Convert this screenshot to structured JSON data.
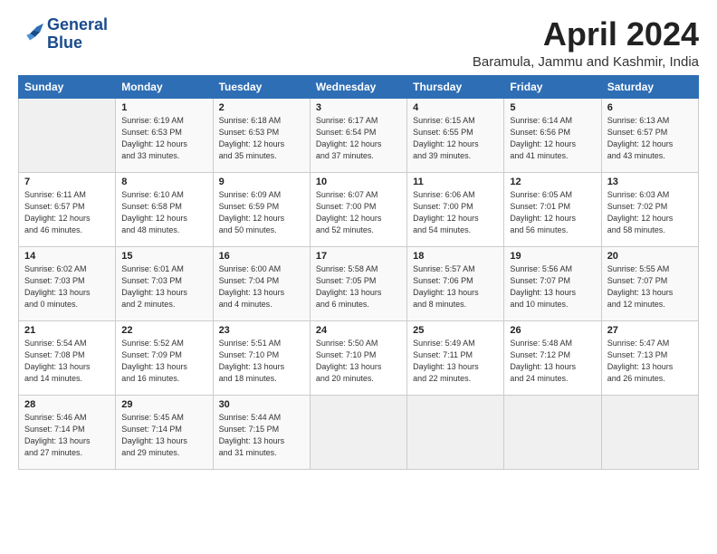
{
  "logo": {
    "line1": "General",
    "line2": "Blue"
  },
  "title": "April 2024",
  "location": "Baramula, Jammu and Kashmir, India",
  "days_of_week": [
    "Sunday",
    "Monday",
    "Tuesday",
    "Wednesday",
    "Thursday",
    "Friday",
    "Saturday"
  ],
  "weeks": [
    [
      {
        "day": "",
        "info": ""
      },
      {
        "day": "1",
        "info": "Sunrise: 6:19 AM\nSunset: 6:53 PM\nDaylight: 12 hours\nand 33 minutes."
      },
      {
        "day": "2",
        "info": "Sunrise: 6:18 AM\nSunset: 6:53 PM\nDaylight: 12 hours\nand 35 minutes."
      },
      {
        "day": "3",
        "info": "Sunrise: 6:17 AM\nSunset: 6:54 PM\nDaylight: 12 hours\nand 37 minutes."
      },
      {
        "day": "4",
        "info": "Sunrise: 6:15 AM\nSunset: 6:55 PM\nDaylight: 12 hours\nand 39 minutes."
      },
      {
        "day": "5",
        "info": "Sunrise: 6:14 AM\nSunset: 6:56 PM\nDaylight: 12 hours\nand 41 minutes."
      },
      {
        "day": "6",
        "info": "Sunrise: 6:13 AM\nSunset: 6:57 PM\nDaylight: 12 hours\nand 43 minutes."
      }
    ],
    [
      {
        "day": "7",
        "info": "Sunrise: 6:11 AM\nSunset: 6:57 PM\nDaylight: 12 hours\nand 46 minutes."
      },
      {
        "day": "8",
        "info": "Sunrise: 6:10 AM\nSunset: 6:58 PM\nDaylight: 12 hours\nand 48 minutes."
      },
      {
        "day": "9",
        "info": "Sunrise: 6:09 AM\nSunset: 6:59 PM\nDaylight: 12 hours\nand 50 minutes."
      },
      {
        "day": "10",
        "info": "Sunrise: 6:07 AM\nSunset: 7:00 PM\nDaylight: 12 hours\nand 52 minutes."
      },
      {
        "day": "11",
        "info": "Sunrise: 6:06 AM\nSunset: 7:00 PM\nDaylight: 12 hours\nand 54 minutes."
      },
      {
        "day": "12",
        "info": "Sunrise: 6:05 AM\nSunset: 7:01 PM\nDaylight: 12 hours\nand 56 minutes."
      },
      {
        "day": "13",
        "info": "Sunrise: 6:03 AM\nSunset: 7:02 PM\nDaylight: 12 hours\nand 58 minutes."
      }
    ],
    [
      {
        "day": "14",
        "info": "Sunrise: 6:02 AM\nSunset: 7:03 PM\nDaylight: 13 hours\nand 0 minutes."
      },
      {
        "day": "15",
        "info": "Sunrise: 6:01 AM\nSunset: 7:03 PM\nDaylight: 13 hours\nand 2 minutes."
      },
      {
        "day": "16",
        "info": "Sunrise: 6:00 AM\nSunset: 7:04 PM\nDaylight: 13 hours\nand 4 minutes."
      },
      {
        "day": "17",
        "info": "Sunrise: 5:58 AM\nSunset: 7:05 PM\nDaylight: 13 hours\nand 6 minutes."
      },
      {
        "day": "18",
        "info": "Sunrise: 5:57 AM\nSunset: 7:06 PM\nDaylight: 13 hours\nand 8 minutes."
      },
      {
        "day": "19",
        "info": "Sunrise: 5:56 AM\nSunset: 7:07 PM\nDaylight: 13 hours\nand 10 minutes."
      },
      {
        "day": "20",
        "info": "Sunrise: 5:55 AM\nSunset: 7:07 PM\nDaylight: 13 hours\nand 12 minutes."
      }
    ],
    [
      {
        "day": "21",
        "info": "Sunrise: 5:54 AM\nSunset: 7:08 PM\nDaylight: 13 hours\nand 14 minutes."
      },
      {
        "day": "22",
        "info": "Sunrise: 5:52 AM\nSunset: 7:09 PM\nDaylight: 13 hours\nand 16 minutes."
      },
      {
        "day": "23",
        "info": "Sunrise: 5:51 AM\nSunset: 7:10 PM\nDaylight: 13 hours\nand 18 minutes."
      },
      {
        "day": "24",
        "info": "Sunrise: 5:50 AM\nSunset: 7:10 PM\nDaylight: 13 hours\nand 20 minutes."
      },
      {
        "day": "25",
        "info": "Sunrise: 5:49 AM\nSunset: 7:11 PM\nDaylight: 13 hours\nand 22 minutes."
      },
      {
        "day": "26",
        "info": "Sunrise: 5:48 AM\nSunset: 7:12 PM\nDaylight: 13 hours\nand 24 minutes."
      },
      {
        "day": "27",
        "info": "Sunrise: 5:47 AM\nSunset: 7:13 PM\nDaylight: 13 hours\nand 26 minutes."
      }
    ],
    [
      {
        "day": "28",
        "info": "Sunrise: 5:46 AM\nSunset: 7:14 PM\nDaylight: 13 hours\nand 27 minutes."
      },
      {
        "day": "29",
        "info": "Sunrise: 5:45 AM\nSunset: 7:14 PM\nDaylight: 13 hours\nand 29 minutes."
      },
      {
        "day": "30",
        "info": "Sunrise: 5:44 AM\nSunset: 7:15 PM\nDaylight: 13 hours\nand 31 minutes."
      },
      {
        "day": "",
        "info": ""
      },
      {
        "day": "",
        "info": ""
      },
      {
        "day": "",
        "info": ""
      },
      {
        "day": "",
        "info": ""
      }
    ]
  ]
}
